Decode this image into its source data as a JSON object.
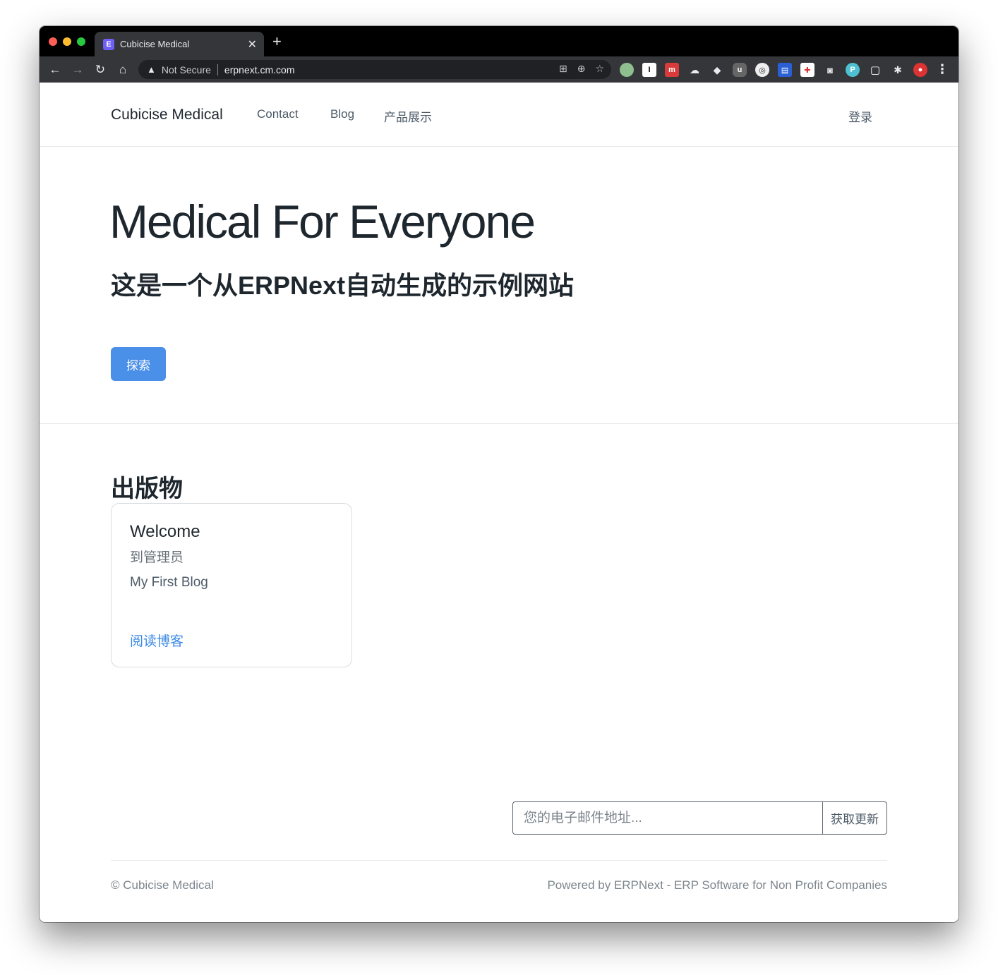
{
  "browser": {
    "tab_title": "Cubicise Medical",
    "tab_favicon_letter": "E",
    "security_label": "Not Secure",
    "url": "erpnext.cm.com",
    "colors": {
      "chrome_dark": "#35363a",
      "omnibox": "#202124"
    }
  },
  "navbar": {
    "brand": "Cubicise Medical",
    "links": [
      "Contact",
      "Blog",
      "产品展示"
    ],
    "login": "登录"
  },
  "hero": {
    "title": "Medical For Everyone",
    "subtitle": "这是一个从ERPNext自动生成的示例网站",
    "button": "探索",
    "button_color": "#4a8fe8"
  },
  "publications": {
    "heading": "出版物",
    "card": {
      "title": "Welcome",
      "subtitle": "到管理员",
      "text": "My First Blog",
      "link": "阅读博客"
    }
  },
  "subscribe": {
    "placeholder": "您的电子邮件地址...",
    "button": "获取更新"
  },
  "footer": {
    "copyright": "© Cubicise Medical",
    "powered": "Powered by ERPNext - ERP Software for Non Profit Companies"
  }
}
